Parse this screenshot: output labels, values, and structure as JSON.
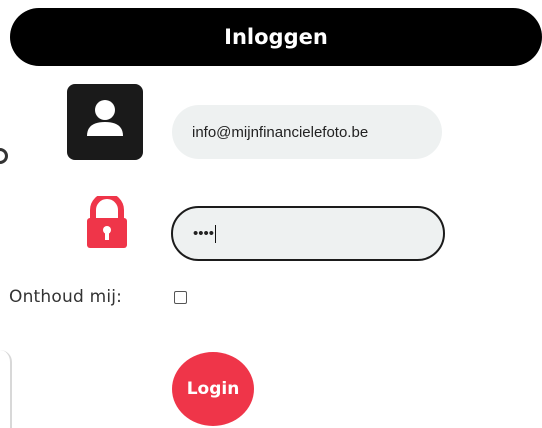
{
  "header": {
    "title": "Inloggen"
  },
  "form": {
    "email_value": "info@mijnfinancielefoto.be",
    "password_mask": "••••",
    "remember_label": "Onthoud mij:",
    "remember_checked": false,
    "login_label": "Login"
  },
  "icons": {
    "user": "user-icon",
    "lock": "lock-icon"
  },
  "colors": {
    "header_bg": "#000000",
    "accent_red": "#ef3549",
    "field_bg": "#eef1f1"
  }
}
